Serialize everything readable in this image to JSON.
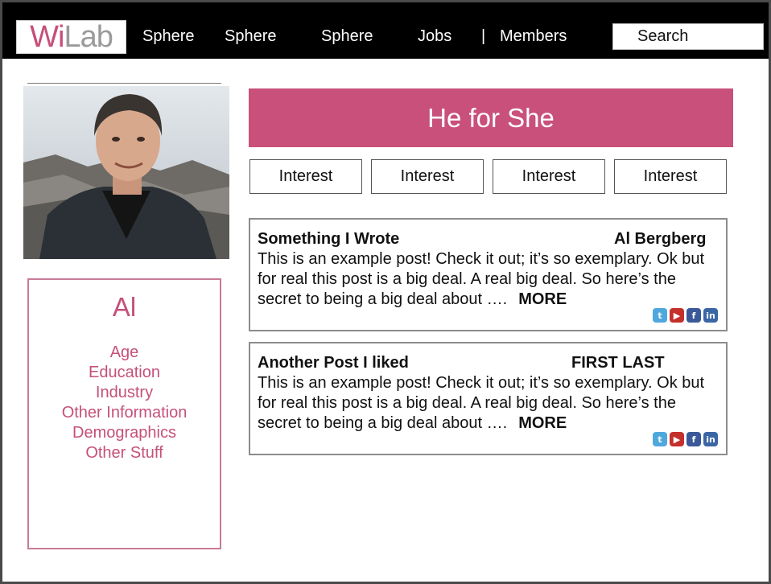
{
  "header": {
    "logo_brand": "Wi",
    "logo_rest": "Lab",
    "nav": [
      "Sphere",
      "Sphere",
      "Sphere",
      "Jobs",
      "Members"
    ],
    "separator": "|",
    "search_placeholder": "Search"
  },
  "profile": {
    "name": "Al",
    "fields": [
      "Age",
      "Education",
      "Industry",
      "Other Information",
      "Demographics",
      "Other Stuff"
    ]
  },
  "banner": {
    "title": "He for She"
  },
  "interests": [
    "Interest",
    "Interest",
    "Interest",
    "Interest"
  ],
  "posts": [
    {
      "title": "Something I Wrote",
      "author": "Al Bergberg",
      "body": "This is an example post! Check it out; it’s so exemplary. Ok but for real this post is a big deal. A real big deal. So here’s the secret to being a big deal  about ….",
      "more": "MORE"
    },
    {
      "title": "Another Post I liked",
      "author": "FIRST LAST",
      "body": "This is an example post! Check it out; it’s so exemplary. Ok but for real this post is a big deal. A real big deal. So here’s the secret to being a big deal  about ….",
      "more": "MORE"
    }
  ],
  "social_icons": [
    "twitter-icon",
    "youtube-icon",
    "facebook-icon",
    "linkedin-icon"
  ],
  "colors": {
    "accent": "#c8507a",
    "topbar": "#000000"
  }
}
